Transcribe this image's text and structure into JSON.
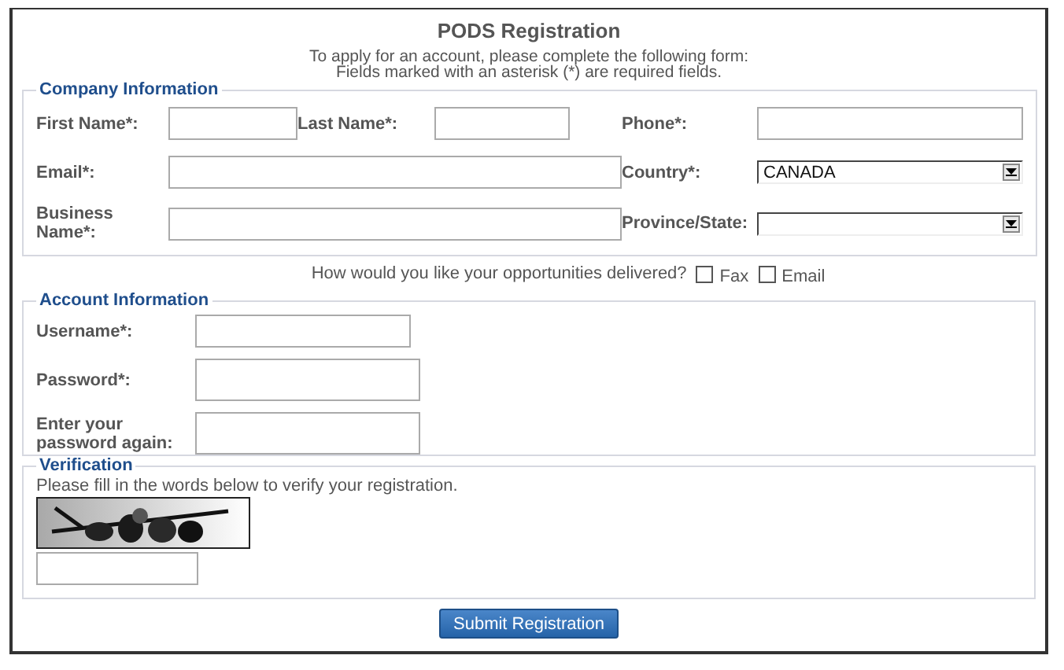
{
  "title": "PODS Registration",
  "intro": [
    "To apply for an account, please complete the following form:",
    "Fields marked with an asterisk (*) are required fields."
  ],
  "company": {
    "legend": "Company Information",
    "rows": [
      [
        {
          "label": "First Name*:",
          "kind": "text"
        },
        {
          "label": "Last Name*:",
          "kind": "text"
        },
        {
          "label": "Phone*:",
          "kind": "text"
        }
      ],
      [
        {
          "label": "Email*:",
          "kind": "text"
        },
        {
          "label": "Country*:",
          "kind": "select",
          "value": "CANADA"
        }
      ],
      [
        {
          "label": "Business Name*:",
          "kind": "text"
        },
        {
          "label": "Province/State:",
          "kind": "select"
        }
      ]
    ]
  },
  "delivery": {
    "question": "How would you like your opportunities delivered?",
    "options": [
      {
        "label": "Fax",
        "checked": false
      },
      {
        "label": "Email",
        "checked": false
      }
    ]
  },
  "account": {
    "legend": "Account Information",
    "fields": [
      {
        "label": "Username*:",
        "kind": "text"
      },
      {
        "label": "Password*:",
        "kind": "password"
      },
      {
        "label": "Enter your password again:",
        "kind": "password"
      }
    ]
  },
  "verification": {
    "legend": "Verification",
    "instruction": "Please fill in the words below to verify your registration."
  },
  "submit": "Submit Registration"
}
